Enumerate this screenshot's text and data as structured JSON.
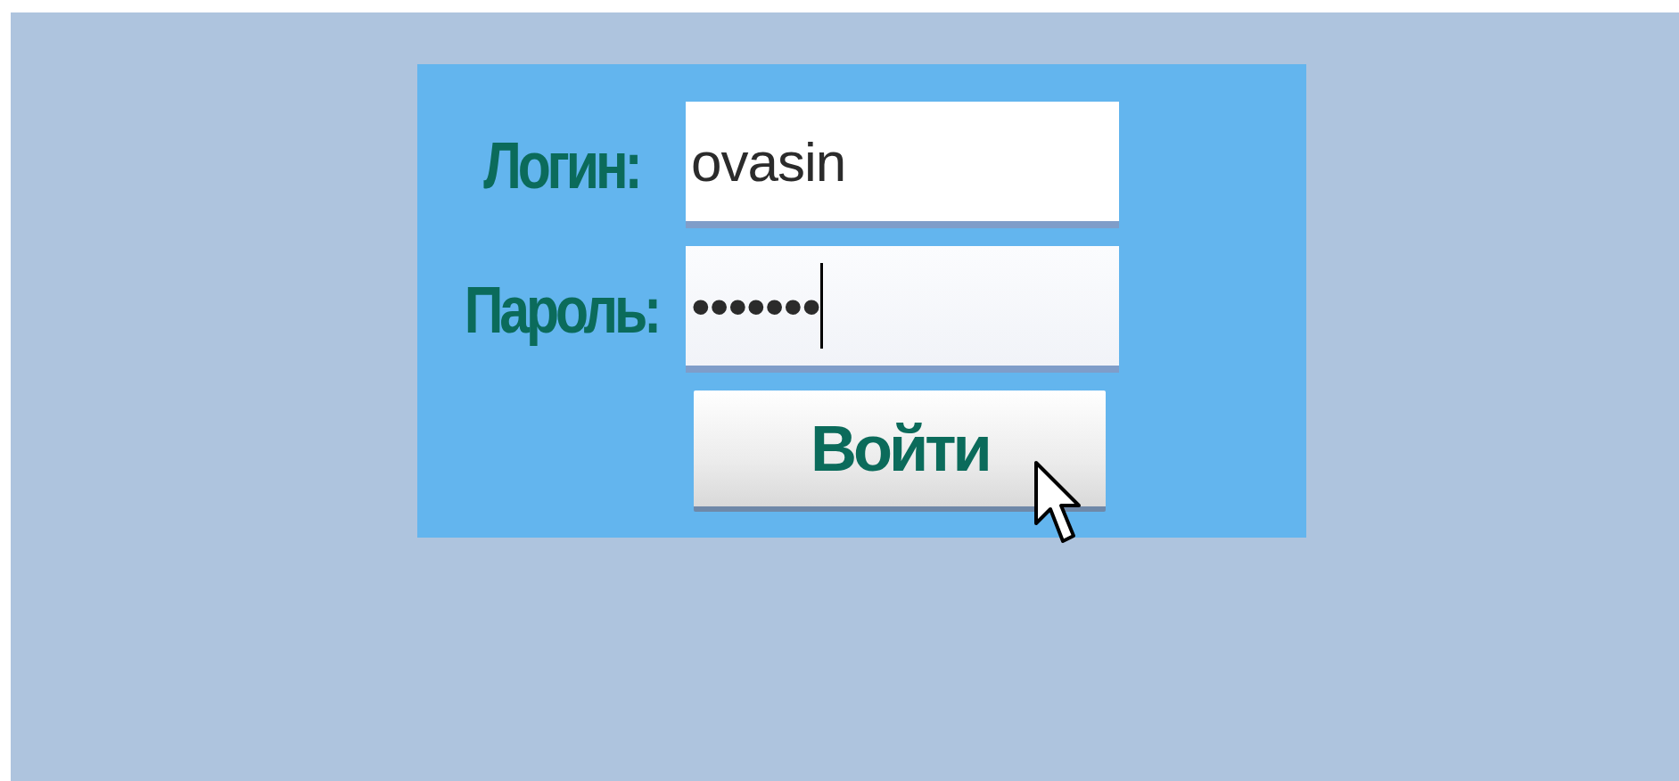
{
  "login_form": {
    "fields": [
      {
        "label": "Логин:",
        "value": "ovasin",
        "focused": false
      },
      {
        "label": "Пароль:",
        "value": "•••••••",
        "focused": true
      }
    ],
    "submit_button": "Войти"
  }
}
